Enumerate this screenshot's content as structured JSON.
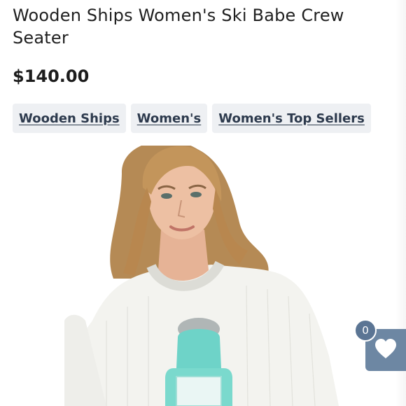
{
  "product": {
    "title": "Wooden Ships Women's Ski Babe Crew Seater",
    "price": "$140.00",
    "image_alt": "Woman wearing white knit crew sweater with teal ski hat graphic"
  },
  "tags": [
    {
      "label": "Wooden Ships"
    },
    {
      "label": "Women's"
    },
    {
      "label": "Women's Top Sellers"
    }
  ],
  "wishlist": {
    "count": "0",
    "icon": "heart-icon",
    "color": "#6d87a3"
  }
}
